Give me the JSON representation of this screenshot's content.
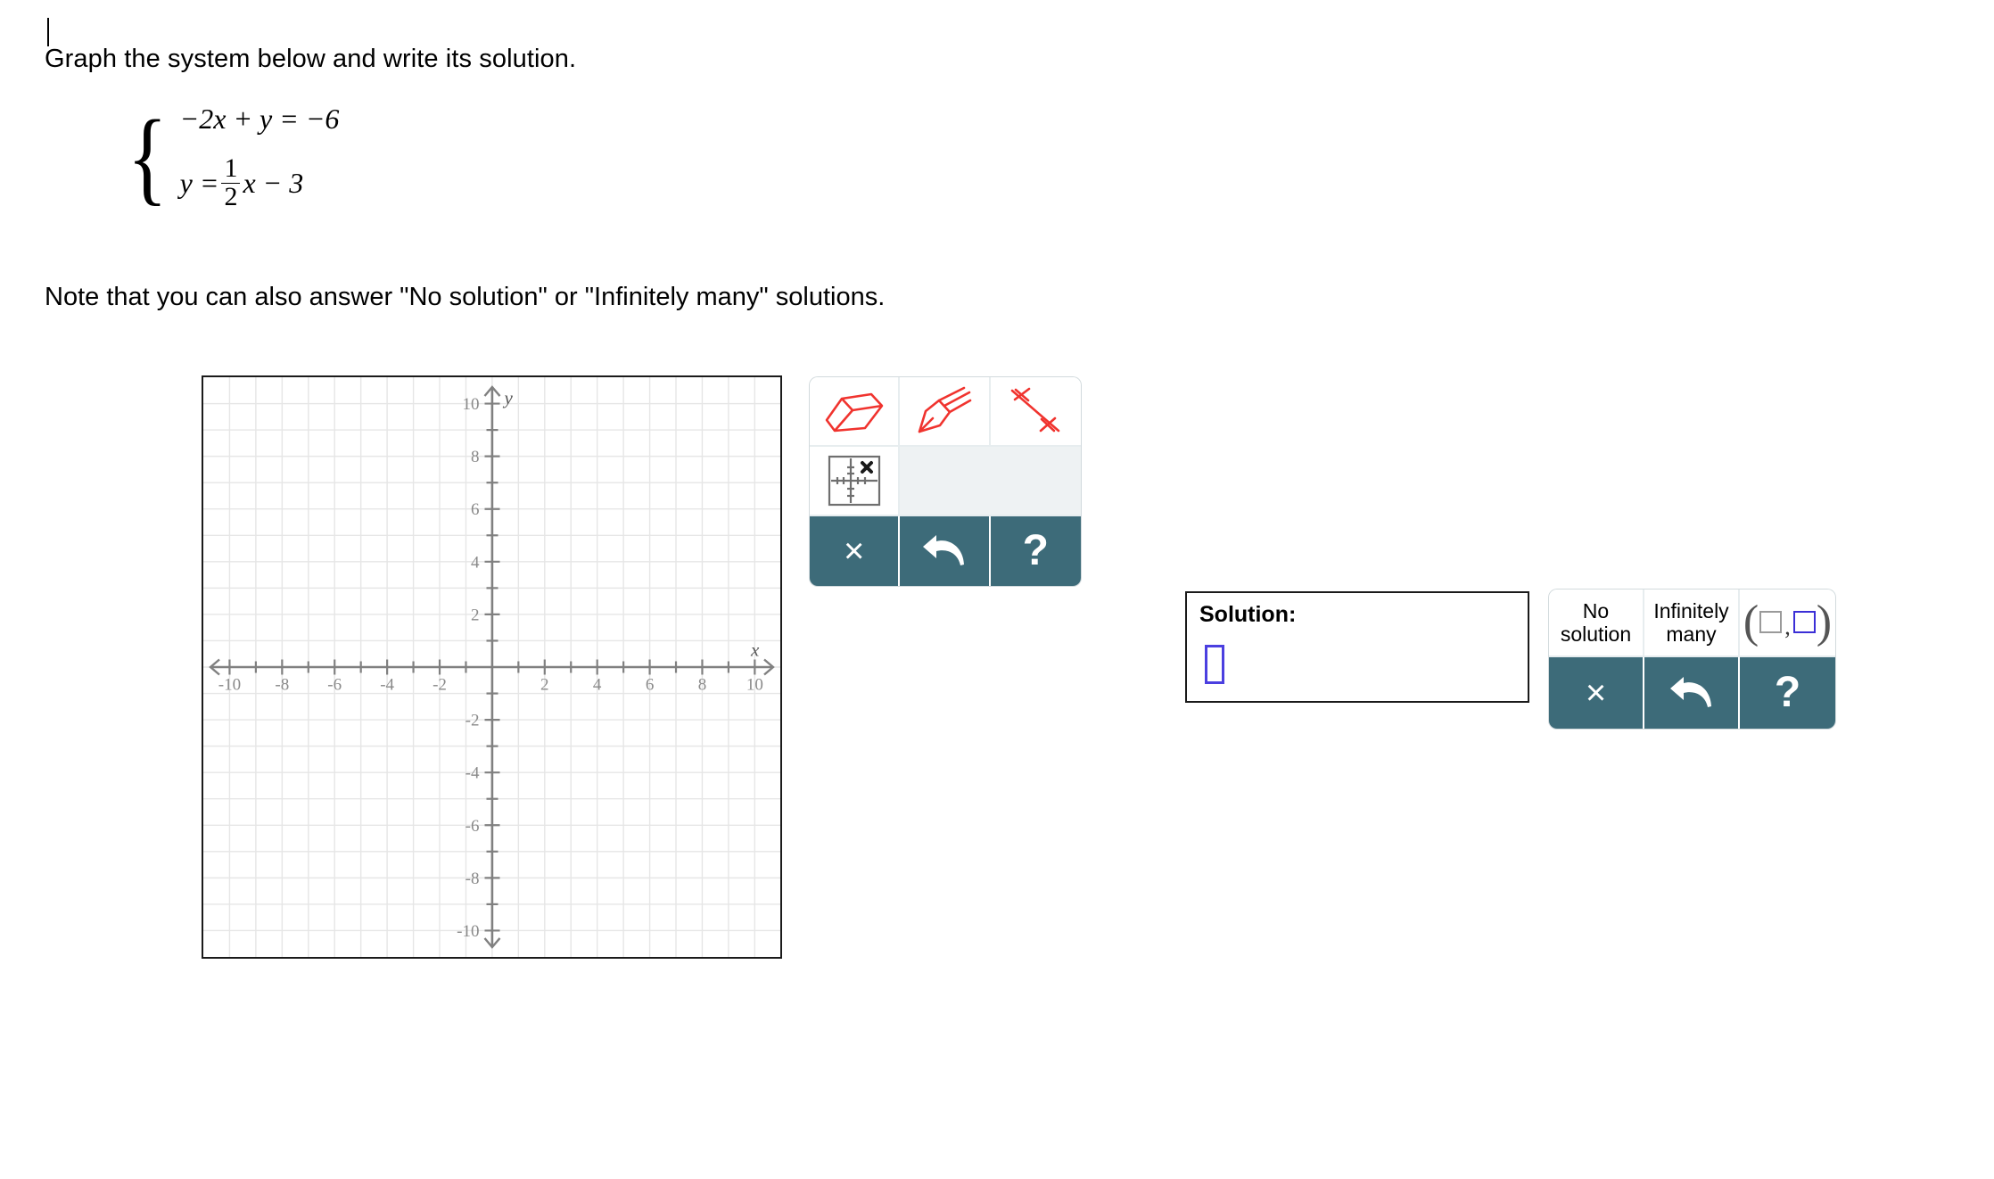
{
  "prompt": {
    "instruction": "Graph the system below and write its solution.",
    "note": "Note that you can also answer \"No solution\" or \"Infinitely many\" solutions."
  },
  "system": {
    "equation1": "−2x + y = −6",
    "equation2_lhs": "y =",
    "equation2_frac_num": "1",
    "equation2_frac_den": "2",
    "equation2_rhs": "x − 3"
  },
  "graph": {
    "x_label": "x",
    "y_label": "y",
    "x_ticks": [
      "-10",
      "-8",
      "-6",
      "-4",
      "-2",
      "2",
      "4",
      "6",
      "8",
      "10"
    ],
    "y_ticks": [
      "10",
      "8",
      "6",
      "4",
      "2",
      "-2",
      "-4",
      "-6",
      "-8",
      "-10"
    ],
    "xlim": [
      -11,
      11
    ],
    "ylim": [
      -11,
      11
    ],
    "grid": true
  },
  "chart_data": {
    "type": "line",
    "title": "",
    "xlabel": "x",
    "ylabel": "y",
    "xlim": [
      -11,
      11
    ],
    "ylim": [
      -11,
      11
    ],
    "grid": true,
    "x_ticks": [
      -10,
      -8,
      -6,
      -4,
      -2,
      2,
      4,
      6,
      8,
      10
    ],
    "y_ticks": [
      10,
      8,
      6,
      4,
      2,
      -2,
      -4,
      -6,
      -8,
      -10
    ],
    "series": []
  },
  "draw_toolbar": {
    "tools": [
      {
        "name": "eraser",
        "label": ""
      },
      {
        "name": "pencil",
        "label": ""
      },
      {
        "name": "line",
        "label": ""
      },
      {
        "name": "plot-point",
        "label": ""
      },
      {
        "name": "blank",
        "label": ""
      }
    ],
    "actions": [
      {
        "name": "clear",
        "label": "×"
      },
      {
        "name": "undo",
        "label": ""
      },
      {
        "name": "help",
        "label": "?"
      }
    ]
  },
  "solution": {
    "label": "Solution:",
    "input_value": "",
    "input_placeholder": ""
  },
  "answer_toolbar": {
    "options": [
      {
        "name": "no-solution",
        "line1": "No",
        "line2": "solution"
      },
      {
        "name": "infinitely-many",
        "line1": "Infinitely",
        "line2": "many"
      },
      {
        "name": "ordered-pair",
        "line1": "",
        "line2": ""
      }
    ],
    "actions": [
      {
        "name": "clear",
        "label": "×"
      },
      {
        "name": "undo",
        "label": ""
      },
      {
        "name": "help",
        "label": "?"
      }
    ]
  },
  "colors": {
    "toolbar_dark": "#3d6b79",
    "tool_red": "#f0332e",
    "input_blue": "#4b3fe0",
    "grid_line": "#e3e3e3",
    "axis": "#808080"
  }
}
